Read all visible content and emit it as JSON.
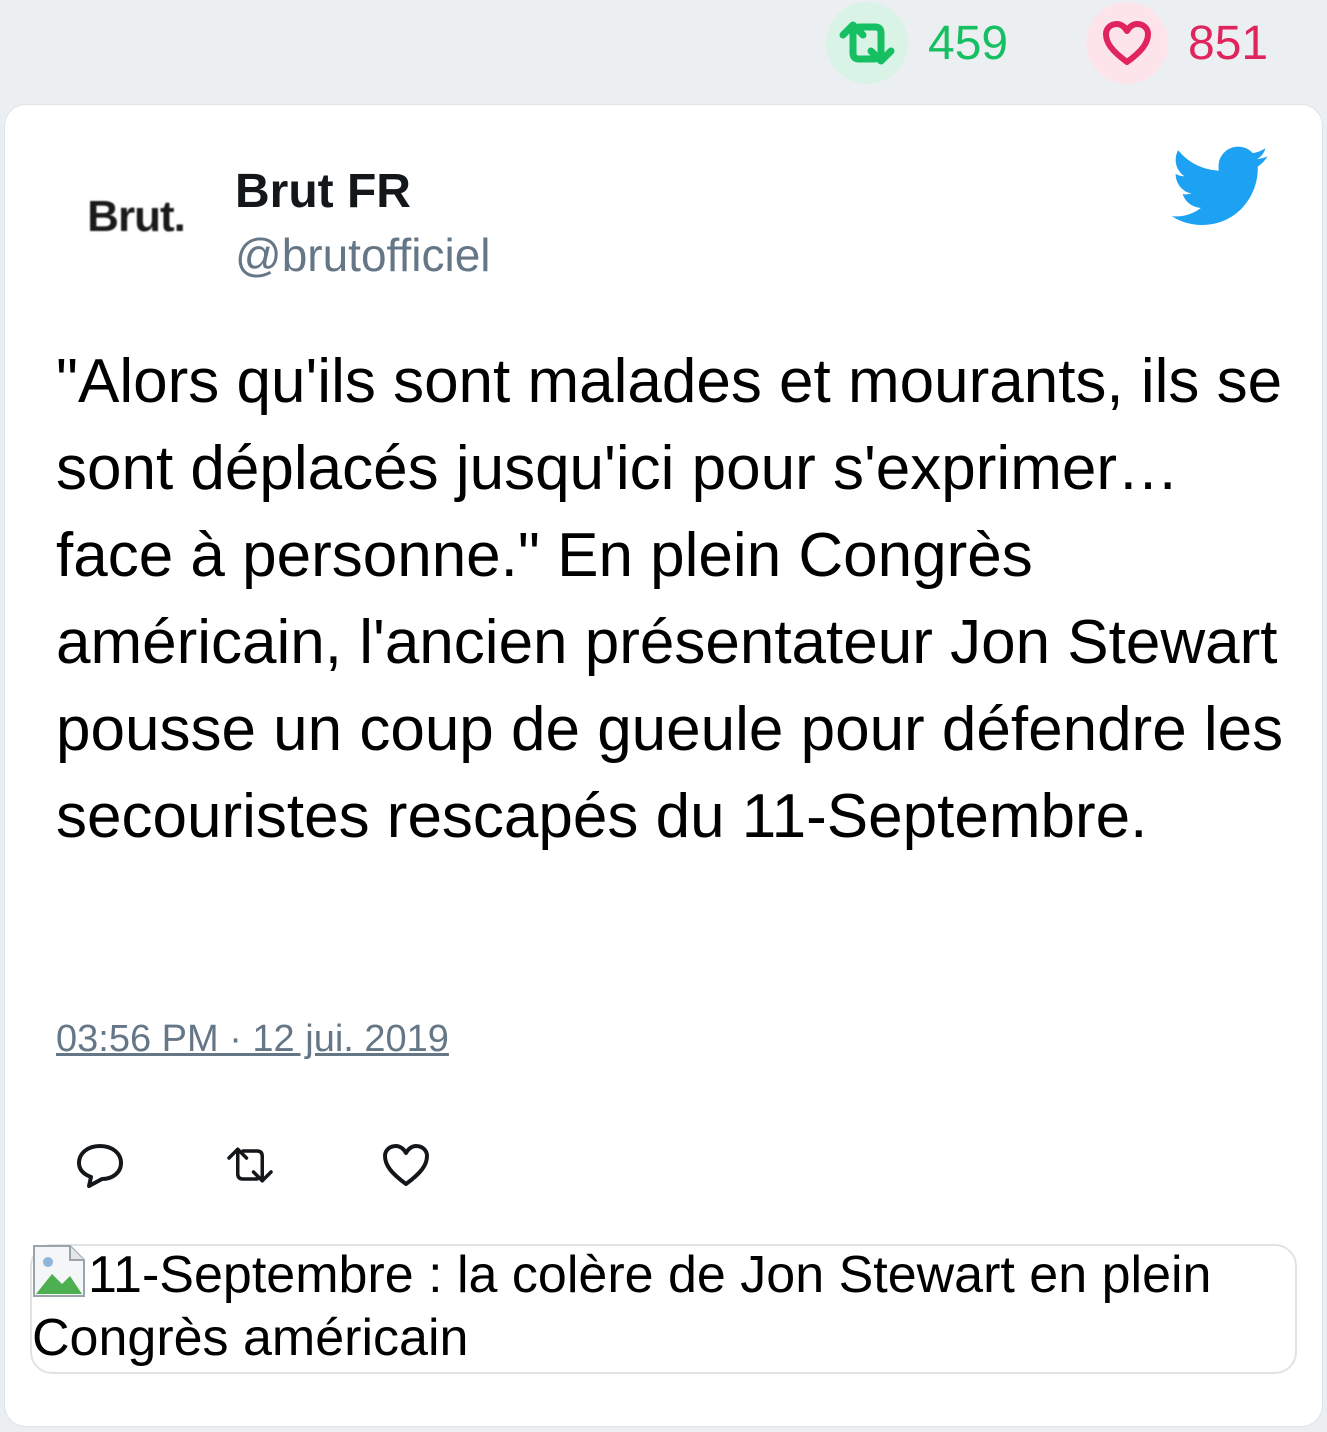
{
  "stats": {
    "retweet_count": "459",
    "like_count": "851",
    "retweet_icon": "retweet-icon",
    "like_icon": "heart-icon",
    "retweet_color": "#17bf63",
    "like_color": "#e0245e"
  },
  "author": {
    "avatar_text": "Brut.",
    "name": "Brut FR",
    "handle": "@brutofficiel"
  },
  "brand_icon": "twitter-bird-icon",
  "brand_color": "#1da1f2",
  "tweet": {
    "text": "\"Alors qu'ils sont malades et mourants, ils se sont déplacés jusqu'ici pour s'exprimer… face à personne.\" En plein Congrès américain, l'ancien présentateur Jon Stewart pousse un coup de gueule pour défendre les secouristes rescapés du 11-Septembre.",
    "timestamp": "03:56 PM · 12 jui. 2019"
  },
  "actions": [
    {
      "icon": "reply-icon"
    },
    {
      "icon": "retweet-icon"
    },
    {
      "icon": "like-icon"
    }
  ],
  "link_card": {
    "title": "11-Septembre : la colère de Jon Stewart en plein Congrès américain"
  }
}
